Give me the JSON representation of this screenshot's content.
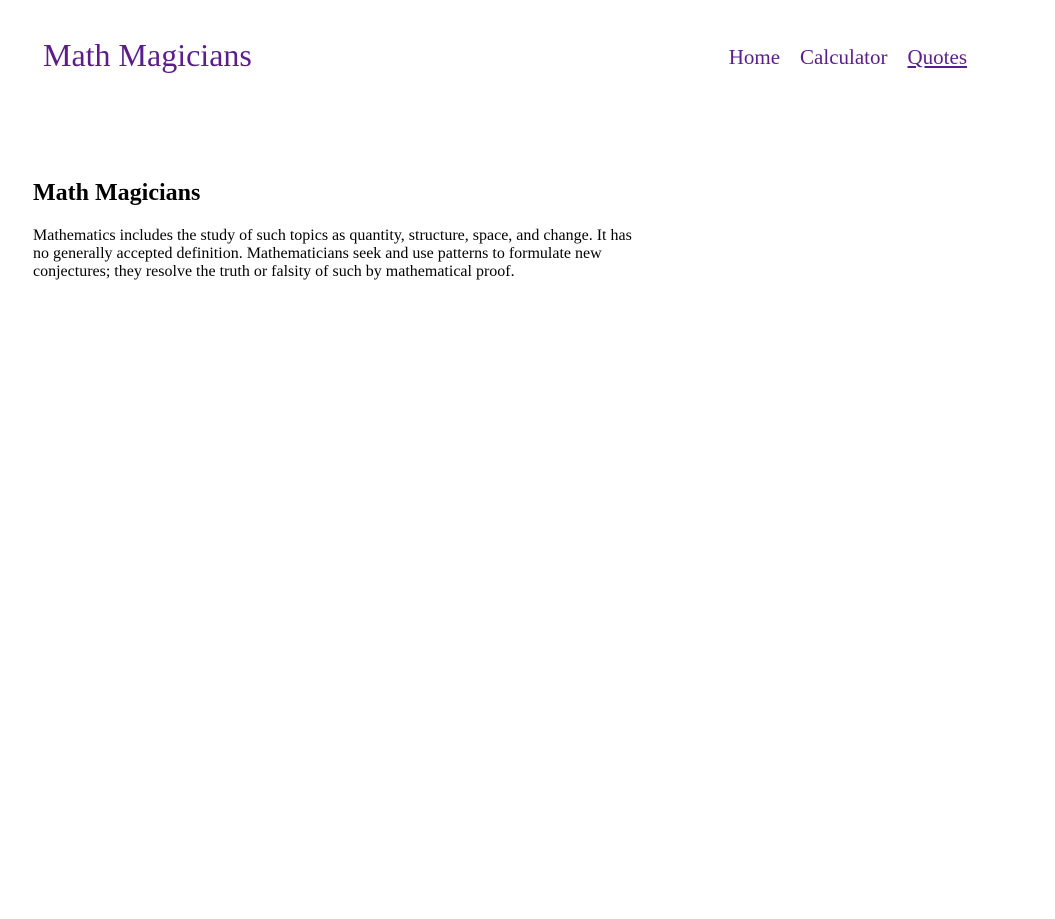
{
  "header": {
    "brand": "Math Magicians",
    "nav": [
      {
        "label": "Home",
        "active": false
      },
      {
        "label": "Calculator",
        "active": false
      },
      {
        "label": "Quotes",
        "active": true
      }
    ]
  },
  "main": {
    "title": "Math Magicians",
    "description": "Mathematics includes the study of such topics as quantity, structure, space, and change. It has no generally accepted definition. Mathematicians seek and use patterns to formulate new conjectures; they resolve the truth or falsity of such by mathematical proof."
  },
  "colors": {
    "accent": "#5b1d8c",
    "text": "#000000",
    "background": "#ffffff"
  }
}
